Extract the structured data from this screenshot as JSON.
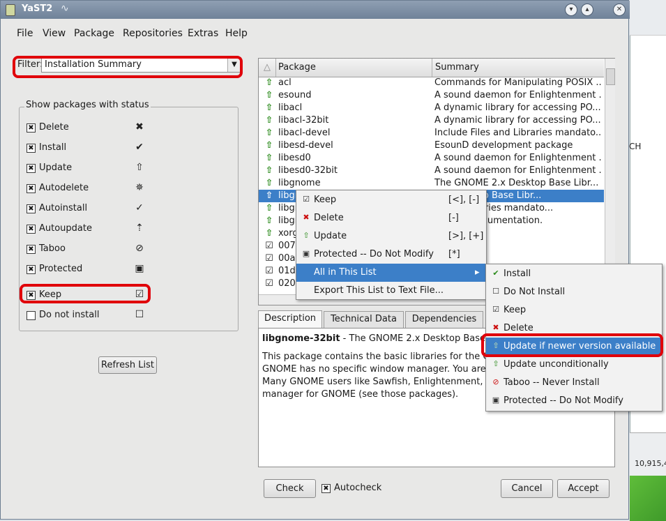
{
  "window": {
    "title": "YaST2"
  },
  "menubar": [
    "File",
    "View",
    "Package",
    "Repositories",
    "Extras",
    "Help"
  ],
  "filter": {
    "label": "Filter:",
    "value": "Installation Summary"
  },
  "status_group": {
    "title": "Show packages with status",
    "items": [
      {
        "label": "Delete",
        "checked": true,
        "icon": "delete-x-icon"
      },
      {
        "label": "Install",
        "checked": true,
        "icon": "install-check-icon"
      },
      {
        "label": "Update",
        "checked": true,
        "icon": "update-arrow-icon"
      },
      {
        "label": "Autodelete",
        "checked": true,
        "icon": "autodelete-icon"
      },
      {
        "label": "Autoinstall",
        "checked": true,
        "icon": "autoinstall-icon"
      },
      {
        "label": "Autoupdate",
        "checked": true,
        "icon": "autoupdate-icon"
      },
      {
        "label": "Taboo",
        "checked": true,
        "icon": "taboo-icon"
      },
      {
        "label": "Protected",
        "checked": true,
        "icon": "lock-icon"
      },
      {
        "label": "Keep",
        "checked": true,
        "icon": "keep-icon"
      },
      {
        "label": "Do not install",
        "checked": false,
        "icon": "empty-box-icon"
      }
    ]
  },
  "refresh_button": "Refresh List",
  "table": {
    "columns": [
      "Package",
      "Summary"
    ],
    "rows": [
      {
        "status": "update",
        "name": "acl",
        "summary": "Commands for Manipulating POSIX ..."
      },
      {
        "status": "update",
        "name": "esound",
        "summary": "A sound daemon for Enlightenment ..."
      },
      {
        "status": "update",
        "name": "libacl",
        "summary": "A dynamic library for accessing PO..."
      },
      {
        "status": "update",
        "name": "libacl-32bit",
        "summary": "A dynamic library for accessing PO..."
      },
      {
        "status": "update",
        "name": "libacl-devel",
        "summary": "Include Files and Libraries mandato..."
      },
      {
        "status": "update",
        "name": "libesd-devel",
        "summary": "EsounD development package"
      },
      {
        "status": "update",
        "name": "libesd0",
        "summary": "A sound daemon for Enlightenment ..."
      },
      {
        "status": "update",
        "name": "libesd0-32bit",
        "summary": "A sound daemon for Enlightenment ..."
      },
      {
        "status": "update",
        "name": "libgnome",
        "summary": "The GNOME 2.x Desktop Base Libr..."
      },
      {
        "status": "update",
        "name": "libgr",
        "summary": "2.x Desktop Base Libr...",
        "selected": true
      },
      {
        "status": "update",
        "name": "libgr",
        "summary": "s and Libraries mandato..."
      },
      {
        "status": "update",
        "name": "libgr",
        "summary": "ackage Documentation."
      },
      {
        "status": "update",
        "name": "xorg",
        "summary": "drivers"
      },
      {
        "status": "keep",
        "name": "0070",
        "summary": ""
      },
      {
        "status": "keep",
        "name": "00a",
        "summary": ""
      },
      {
        "status": "keep",
        "name": "01d",
        "summary": ""
      },
      {
        "status": "keep",
        "name": "020a",
        "summary": ""
      }
    ]
  },
  "tabs": [
    "Description",
    "Technical Data",
    "Dependencies"
  ],
  "description": {
    "heading": "libgnome-32bit",
    "heading_rest": " - The GNOME 2.x Desktop Base",
    "lines": [
      "This package contains the basic libraries for the GN",
      "GNOME has no specific window manager. You are t",
      "Many GNOME users like Sawfish, Enlightenment, or",
      "manager for GNOME (see those packages)."
    ]
  },
  "bottom": {
    "check": "Check",
    "autocheck": "Autocheck",
    "cancel": "Cancel",
    "accept": "Accept"
  },
  "context_menu": [
    {
      "label": "Keep",
      "shortcut": "[<], [-]",
      "icon": "keep-icon"
    },
    {
      "label": "Delete",
      "shortcut": "[-]",
      "icon": "delete-x-icon"
    },
    {
      "label": "Update",
      "shortcut": "[>], [+]",
      "icon": "update-arrow-icon"
    },
    {
      "label": "Protected -- Do Not Modify",
      "shortcut": "[*]",
      "icon": "lock-icon"
    },
    {
      "label": "All in This List",
      "shortcut": "",
      "icon": "",
      "submenu": true,
      "highlighted": true
    },
    {
      "label": "Export This List to Text File...",
      "shortcut": "",
      "icon": ""
    }
  ],
  "submenu": [
    {
      "label": "Install",
      "icon": "install-check-icon"
    },
    {
      "label": "Do Not Install",
      "icon": "empty-box-icon"
    },
    {
      "label": "Keep",
      "icon": "keep-icon"
    },
    {
      "label": "Delete",
      "icon": "delete-x-icon"
    },
    {
      "label": "Update if newer version available",
      "icon": "update-arrow-icon",
      "highlighted": true
    },
    {
      "label": "Update unconditionally",
      "icon": "update-arrow-icon"
    },
    {
      "label": "Taboo -- Never Install",
      "icon": "taboo-icon"
    },
    {
      "label": "Protected -- Do Not Modify",
      "icon": "lock-icon"
    }
  ],
  "background": {
    "partial_text": "CH",
    "count": "10,915,4"
  }
}
